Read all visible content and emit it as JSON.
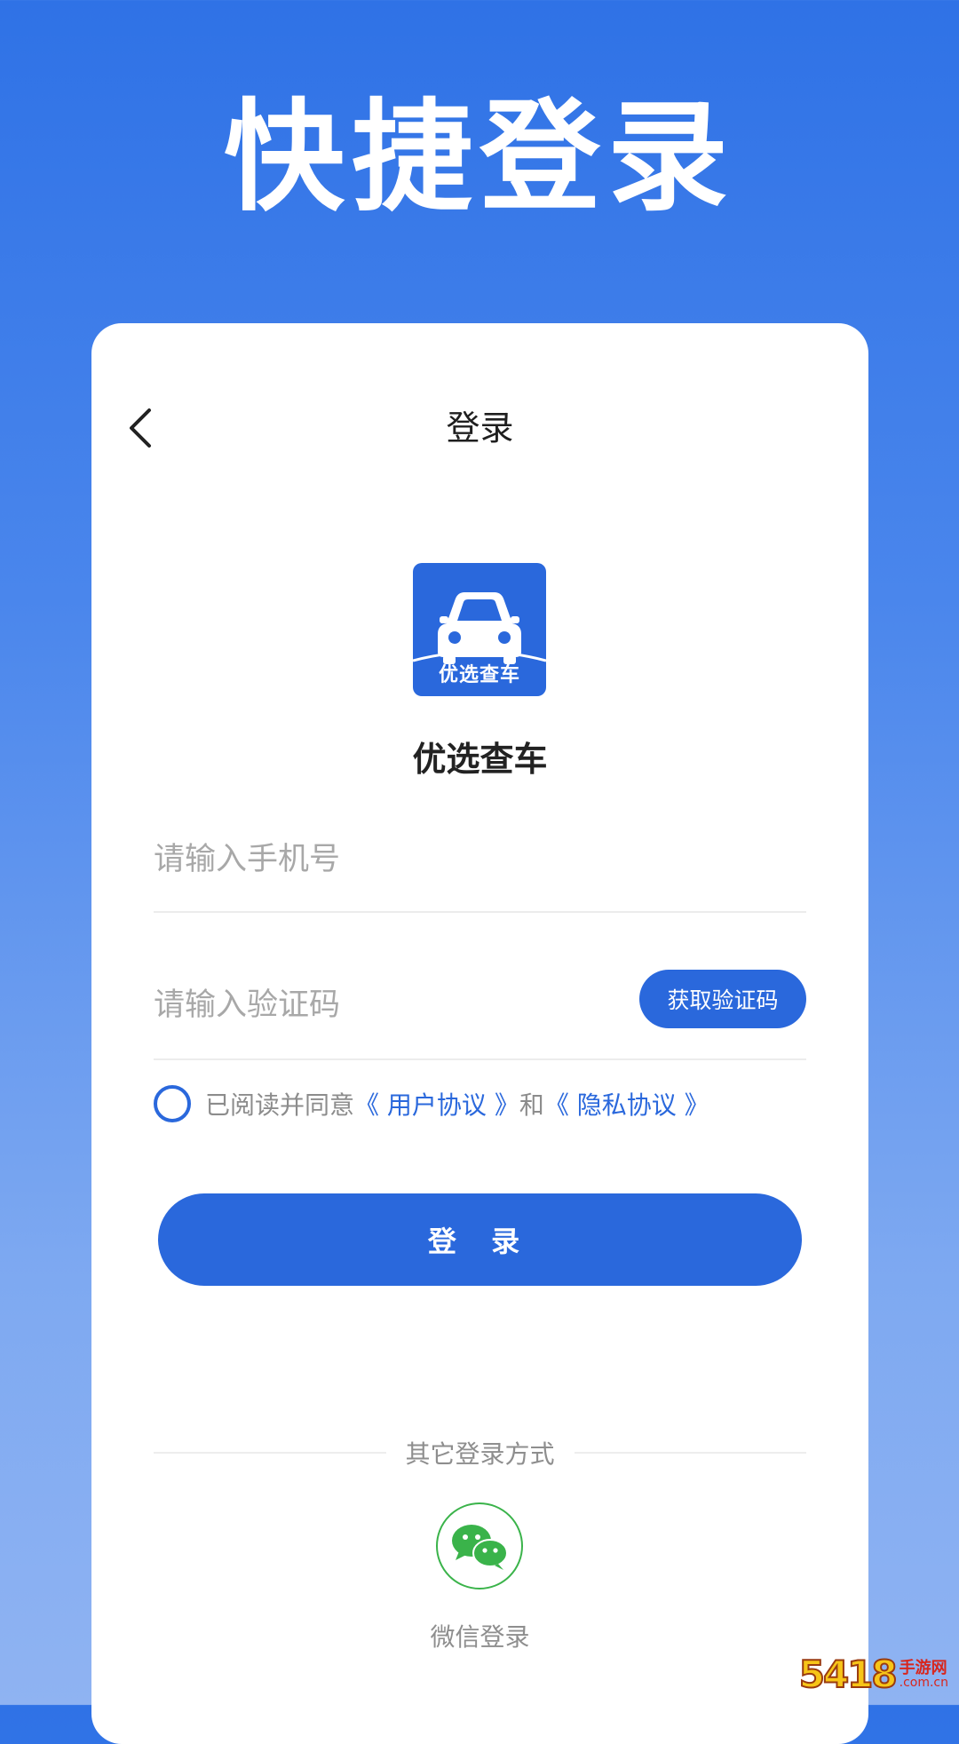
{
  "hero": {
    "title": "快捷登录"
  },
  "card": {
    "title": "登录",
    "back_icon": "chevron-left-icon",
    "app_logo_text": "优选查车",
    "app_name": "优选查车",
    "phone_placeholder": "请输入手机号",
    "code_placeholder": "请输入验证码",
    "get_code_label": "获取验证码",
    "agreement": {
      "prefix": "已阅读并同意",
      "user_agreement": "《 用户协议 》",
      "and": "和",
      "privacy_agreement": "《 隐私协议 》"
    },
    "login_label": "登 录",
    "other_login_label": "其它登录方式",
    "wechat_label": "微信登录",
    "wechat_icon": "wechat-icon"
  },
  "watermark": {
    "number": "5418",
    "text": "手游网",
    "sub": ".com.cn"
  },
  "colors": {
    "primary": "#2a68dc",
    "wechat_green": "#3ab34a",
    "background_top": "#2f72e6",
    "background_bottom": "#8fb3f2"
  }
}
